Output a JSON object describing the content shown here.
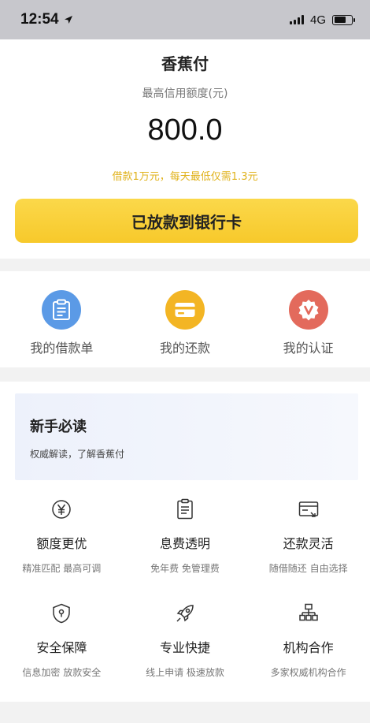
{
  "status_bar": {
    "time": "12:54",
    "network": "4G",
    "battery_level": 0.7
  },
  "header": {
    "app_title": "香蕉付"
  },
  "credit": {
    "limit_label": "最高信用额度(元)",
    "limit_value": "800.0",
    "promo": "借款1万元，每天最低仅需1.3元"
  },
  "main_button": {
    "label": "已放款到银行卡"
  },
  "quick_actions": [
    {
      "label": "我的借款单",
      "icon": "clipboard-icon",
      "color": "#5b9ae6"
    },
    {
      "label": "我的还款",
      "icon": "card-icon",
      "color": "#f3b524"
    },
    {
      "label": "我的认证",
      "icon": "badge-v-icon",
      "color": "#e36a5c"
    }
  ],
  "guide": {
    "title": "新手必读",
    "subtitle": "权威解读，了解香蕉付"
  },
  "features": [
    {
      "title": "额度更优",
      "desc": "精准匹配 最高可调",
      "icon": "yen-circle-icon"
    },
    {
      "title": "息费透明",
      "desc": "免年费 免管理费",
      "icon": "document-icon"
    },
    {
      "title": "还款灵活",
      "desc": "随借随还 自由选择",
      "icon": "card-arrow-icon"
    },
    {
      "title": "安全保障",
      "desc": "信息加密 放款安全",
      "icon": "shield-lock-icon"
    },
    {
      "title": "专业快捷",
      "desc": "线上申请 极速放款",
      "icon": "rocket-icon"
    },
    {
      "title": "机构合作",
      "desc": "多家权威机构合作",
      "icon": "org-chart-icon"
    }
  ],
  "colors": {
    "accent": "#f7c92b",
    "promo_text": "#e0b21b"
  }
}
